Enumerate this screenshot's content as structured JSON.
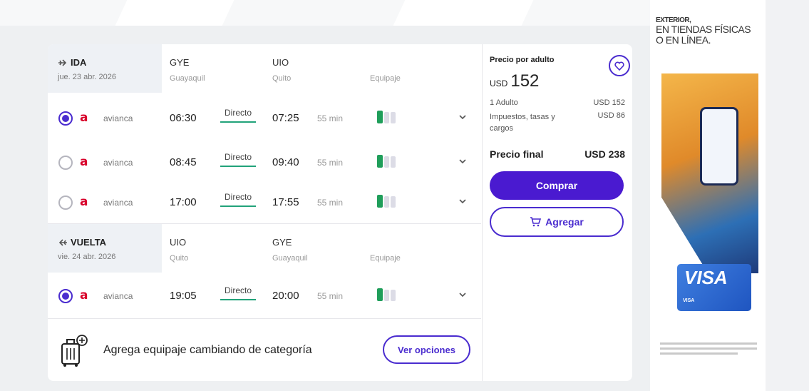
{
  "colors": {
    "accent": "#4a2ccf",
    "buy": "#4a1ad0",
    "avianca": "#d8002a",
    "direct_underline": "#22a37a",
    "bag": "#1f9e5a"
  },
  "outbound": {
    "label": "IDA",
    "date": "jue. 23 abr. 2026",
    "origin_code": "GYE",
    "origin_city": "Guayaquil",
    "dest_code": "UIO",
    "dest_city": "Quito",
    "equipment_label": "Equipaje",
    "flights": [
      {
        "selected": true,
        "airline": "avianca",
        "depart": "06:30",
        "stops": "Directo",
        "arrive": "07:25",
        "duration": "55 min"
      },
      {
        "selected": false,
        "airline": "avianca",
        "depart": "08:45",
        "stops": "Directo",
        "arrive": "09:40",
        "duration": "55 min"
      },
      {
        "selected": false,
        "airline": "avianca",
        "depart": "17:00",
        "stops": "Directo",
        "arrive": "17:55",
        "duration": "55 min"
      }
    ]
  },
  "return": {
    "label": "VUELTA",
    "date": "vie. 24 abr. 2026",
    "origin_code": "UIO",
    "origin_city": "Quito",
    "dest_code": "GYE",
    "dest_city": "Guayaquil",
    "equipment_label": "Equipaje",
    "flights": [
      {
        "selected": true,
        "airline": "avianca",
        "depart": "19:05",
        "stops": "Directo",
        "arrive": "20:00",
        "duration": "55 min"
      }
    ]
  },
  "airline_logo": "a",
  "bottom": {
    "text": "Agrega equipaje cambiando de categoría",
    "button": "Ver opciones"
  },
  "price": {
    "title": "Precio por adulto",
    "currency": "USD",
    "amount": "152",
    "adult_label": "1 Adulto",
    "adult_value": "USD 152",
    "taxes_label": "Impuestos, tasas y cargos",
    "taxes_value": "USD 86",
    "final_label": "Precio final",
    "final_value": "USD 238",
    "buy_button": "Comprar",
    "add_button": "Agregar"
  },
  "ad": {
    "line1": "EXTERIOR,",
    "line2": "EN TIENDAS FÍSICAS",
    "line3": "O EN LÍNEA.",
    "brand": "VISA",
    "card_small": "VISA"
  }
}
